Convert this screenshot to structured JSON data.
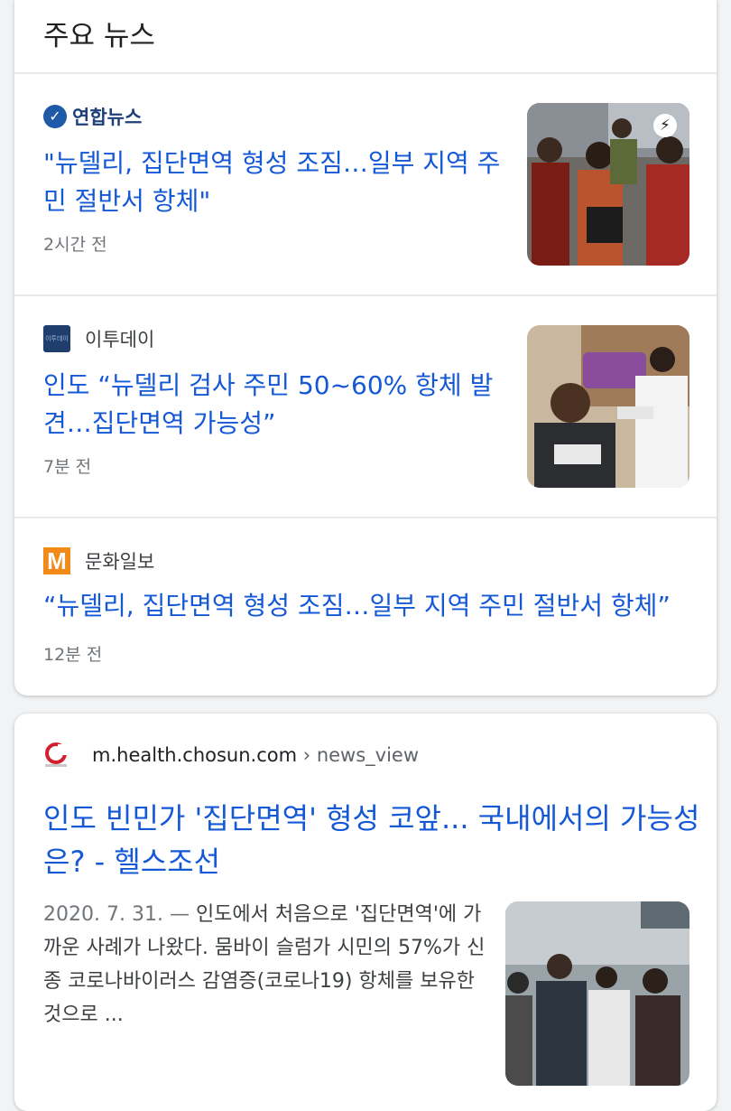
{
  "top_news": {
    "title": "주요 뉴스",
    "items": [
      {
        "source": "연합뉴스",
        "headline": "\"뉴델리, 집단면역 형성 조짐…일부 지역 주민 절반서 항체\"",
        "time": "2시간 전",
        "amp_icon": "lightning-icon"
      },
      {
        "source": "이투데이",
        "headline": "인도 “뉴델리 검사 주민 50~60% 항체 발견…집단면역 가능성”",
        "time": "7분 전"
      },
      {
        "source": "문화일보",
        "headline": "“뉴델리, 집단면역 형성 조짐…일부 지역 주민 절반서 항체”",
        "time": "12분 전"
      }
    ]
  },
  "result": {
    "domain": "m.health.chosun.com",
    "path": " › news_view",
    "title": "인도 빈민가 '집단면역' 형성 코앞... 국내에서의 가능성은? - 헬스조선",
    "date": "2020. 7. 31. — ",
    "snippet": "인도에서 처음으로 '집단면역'에 가까운 사례가 나왔다. 뭄바이 슬럼가 시민의 57%가 신종 코로나바이러스 감염증(코로나19) 항체를 보유한 것으로 ..."
  },
  "colors": {
    "link": "#1558d6",
    "text": "#202124",
    "meta": "#70757a"
  }
}
